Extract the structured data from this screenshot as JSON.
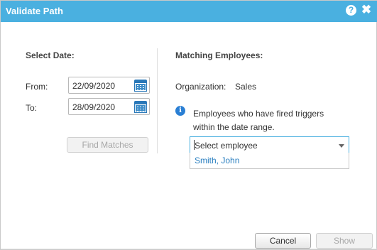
{
  "dialog": {
    "title": "Validate Path",
    "help_icon_glyph": "?",
    "close_icon_glyph": "✖"
  },
  "left": {
    "heading": "Select Date:",
    "from_label": "From:",
    "from_value": "22/09/2020",
    "to_label": "To:",
    "to_value": "28/09/2020",
    "find_matches_label": "Find Matches"
  },
  "right": {
    "heading": "Matching Employees:",
    "org_label": "Organization:",
    "org_value": "Sales",
    "info_icon_glyph": "i",
    "info_text": "Employees who have fired triggers within the date range.",
    "select_placeholder": "Select employee",
    "options": [
      "Smith, John"
    ]
  },
  "footer": {
    "cancel_label": "Cancel",
    "show_label": "Show"
  },
  "colors": {
    "titlebar": "#4ab0e0",
    "accent": "#2a7fc0"
  },
  "icons": [
    "help-icon",
    "close-icon",
    "calendar-icon",
    "info-icon",
    "chevron-down-icon"
  ]
}
